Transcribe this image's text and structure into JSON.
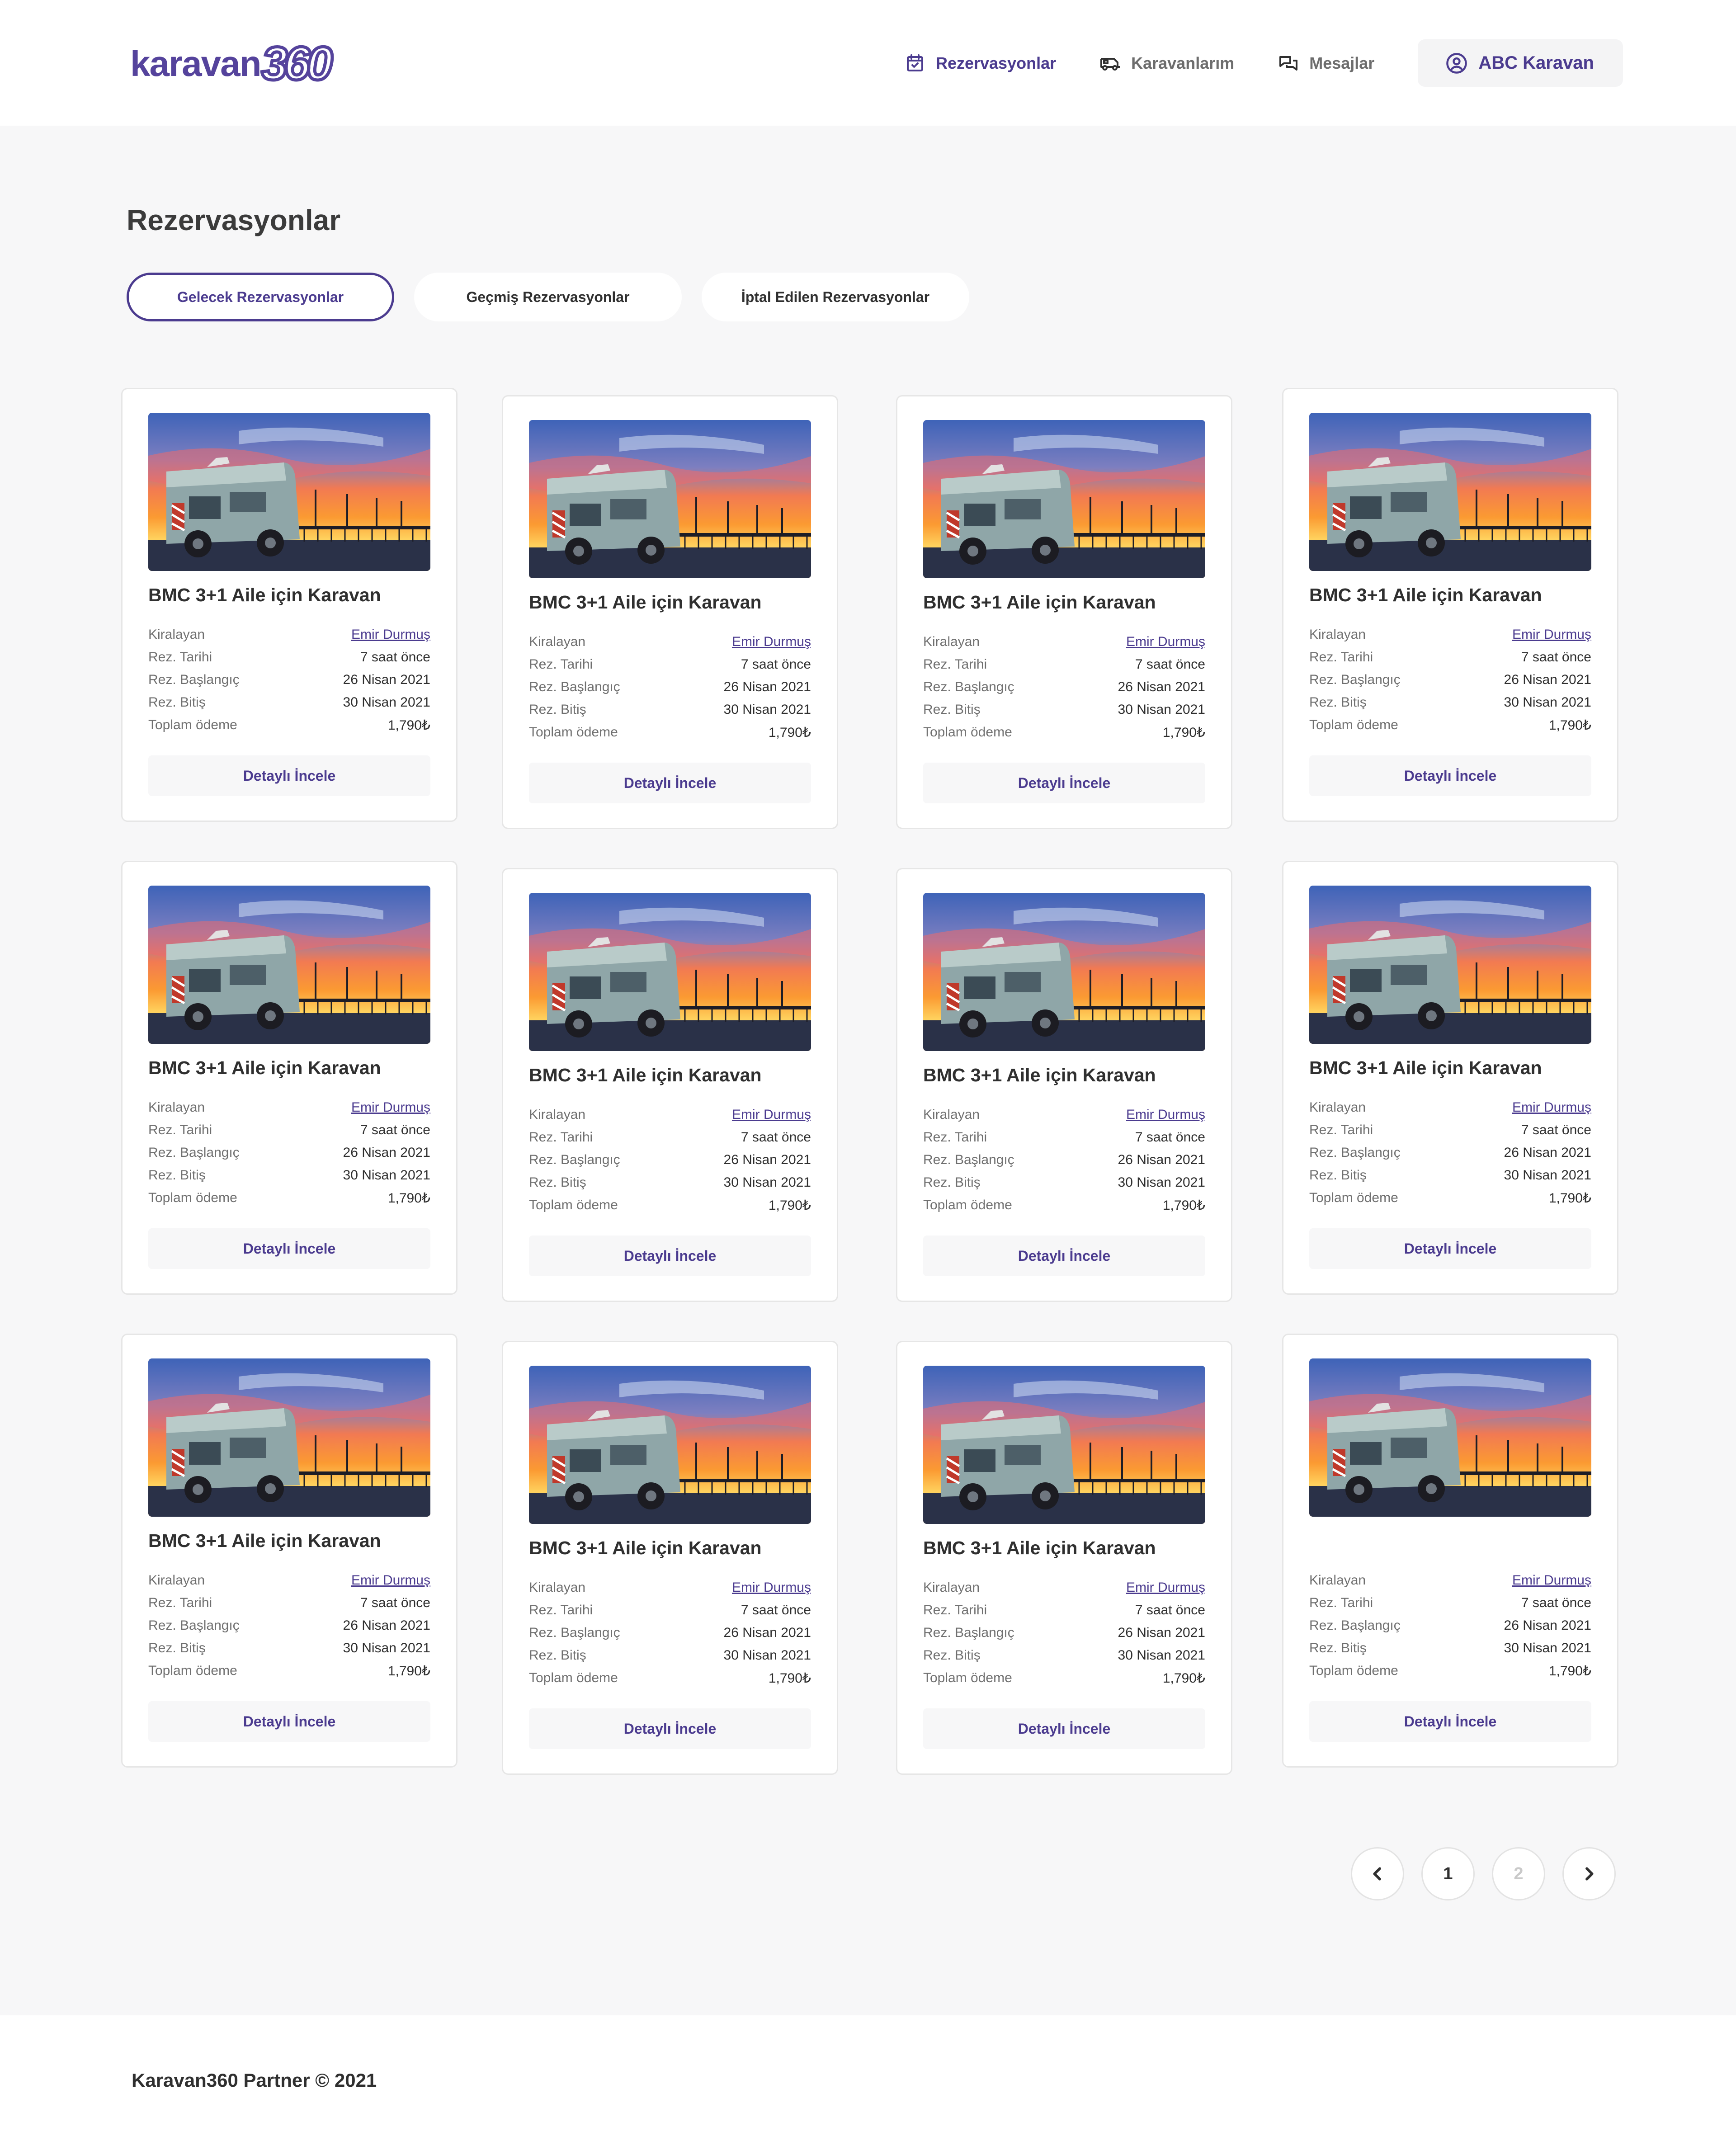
{
  "header": {
    "logo_text": "karavan",
    "logo_number": "360",
    "nav": [
      {
        "label": "Rezervasyonlar",
        "icon": "calendar-check-icon",
        "active": true
      },
      {
        "label": "Karavanlarım",
        "icon": "caravan-icon",
        "active": false
      },
      {
        "label": "Mesajlar",
        "icon": "chat-bubbles-icon",
        "active": false
      }
    ],
    "account_label": "ABC Karavan",
    "account_icon": "user-circle-icon"
  },
  "page": {
    "title": "Rezervasyonlar",
    "tabs": [
      {
        "label": "Gelecek Rezervasyonlar",
        "active": true
      },
      {
        "label": "Geçmiş Rezervasyonlar",
        "active": false
      },
      {
        "label": "İptal Edilen Rezervasyonlar",
        "active": false
      }
    ]
  },
  "labels": {
    "renter": "Kiralayan",
    "res_date": "Rez. Tarihi",
    "res_start": "Rez. Başlangıç",
    "res_end": "Rez. Bitiş",
    "total": "Toplam ödeme",
    "detail_button": "Detaylı İncele"
  },
  "reservations": [
    {
      "title": "BMC 3+1 Aile için Karavan",
      "renter": "Emir Durmuş",
      "res_date": "7 saat önce",
      "start": "26 Nisan 2021",
      "end": "30 Nisan 2021",
      "total": "1,790₺"
    },
    {
      "title": "BMC 3+1 Aile için Karavan",
      "renter": "Emir Durmuş",
      "res_date": "7 saat önce",
      "start": "26 Nisan 2021",
      "end": "30 Nisan 2021",
      "total": "1,790₺"
    },
    {
      "title": "BMC 3+1 Aile için Karavan",
      "renter": "Emir Durmuş",
      "res_date": "7 saat önce",
      "start": "26 Nisan 2021",
      "end": "30 Nisan 2021",
      "total": "1,790₺"
    },
    {
      "title": "BMC 3+1 Aile için Karavan",
      "renter": "Emir Durmuş",
      "res_date": "7 saat önce",
      "start": "26 Nisan 2021",
      "end": "30 Nisan 2021",
      "total": "1,790₺"
    },
    {
      "title": "BMC 3+1 Aile için Karavan",
      "renter": "Emir Durmuş",
      "res_date": "7 saat önce",
      "start": "26 Nisan 2021",
      "end": "30 Nisan 2021",
      "total": "1,790₺"
    },
    {
      "title": "BMC 3+1 Aile için Karavan",
      "renter": "Emir Durmuş",
      "res_date": "7 saat önce",
      "start": "26 Nisan 2021",
      "end": "30 Nisan 2021",
      "total": "1,790₺"
    },
    {
      "title": "BMC 3+1 Aile için Karavan",
      "renter": "Emir Durmuş",
      "res_date": "7 saat önce",
      "start": "26 Nisan 2021",
      "end": "30 Nisan 2021",
      "total": "1,790₺"
    },
    {
      "title": "BMC 3+1 Aile için Karavan",
      "renter": "Emir Durmuş",
      "res_date": "7 saat önce",
      "start": "26 Nisan 2021",
      "end": "30 Nisan 2021",
      "total": "1,790₺"
    },
    {
      "title": "BMC 3+1 Aile için Karavan",
      "renter": "Emir Durmuş",
      "res_date": "7 saat önce",
      "start": "26 Nisan 2021",
      "end": "30 Nisan 2021",
      "total": "1,790₺"
    },
    {
      "title": "BMC 3+1 Aile için Karavan",
      "renter": "Emir Durmuş",
      "res_date": "7 saat önce",
      "start": "26 Nisan 2021",
      "end": "30 Nisan 2021",
      "total": "1,790₺"
    },
    {
      "title": "BMC 3+1 Aile için Karavan",
      "renter": "Emir Durmuş",
      "res_date": "7 saat önce",
      "start": "26 Nisan 2021",
      "end": "30 Nisan 2021",
      "total": "1,790₺"
    },
    {
      "title": "",
      "renter": "Emir Durmuş",
      "res_date": "7 saat önce",
      "start": "26 Nisan 2021",
      "end": "30 Nisan 2021",
      "total": "1,790₺"
    }
  ],
  "pagination": {
    "prev_icon": "chevron-left-icon",
    "next_icon": "chevron-right-icon",
    "pages": [
      "1",
      "2"
    ],
    "current": "1"
  },
  "footer": {
    "text": "Karavan360 Partner © 2021"
  },
  "colors": {
    "brand": "#4b3b8f",
    "page_bg": "#f7f7f8",
    "card_border": "#e6e6e6"
  }
}
